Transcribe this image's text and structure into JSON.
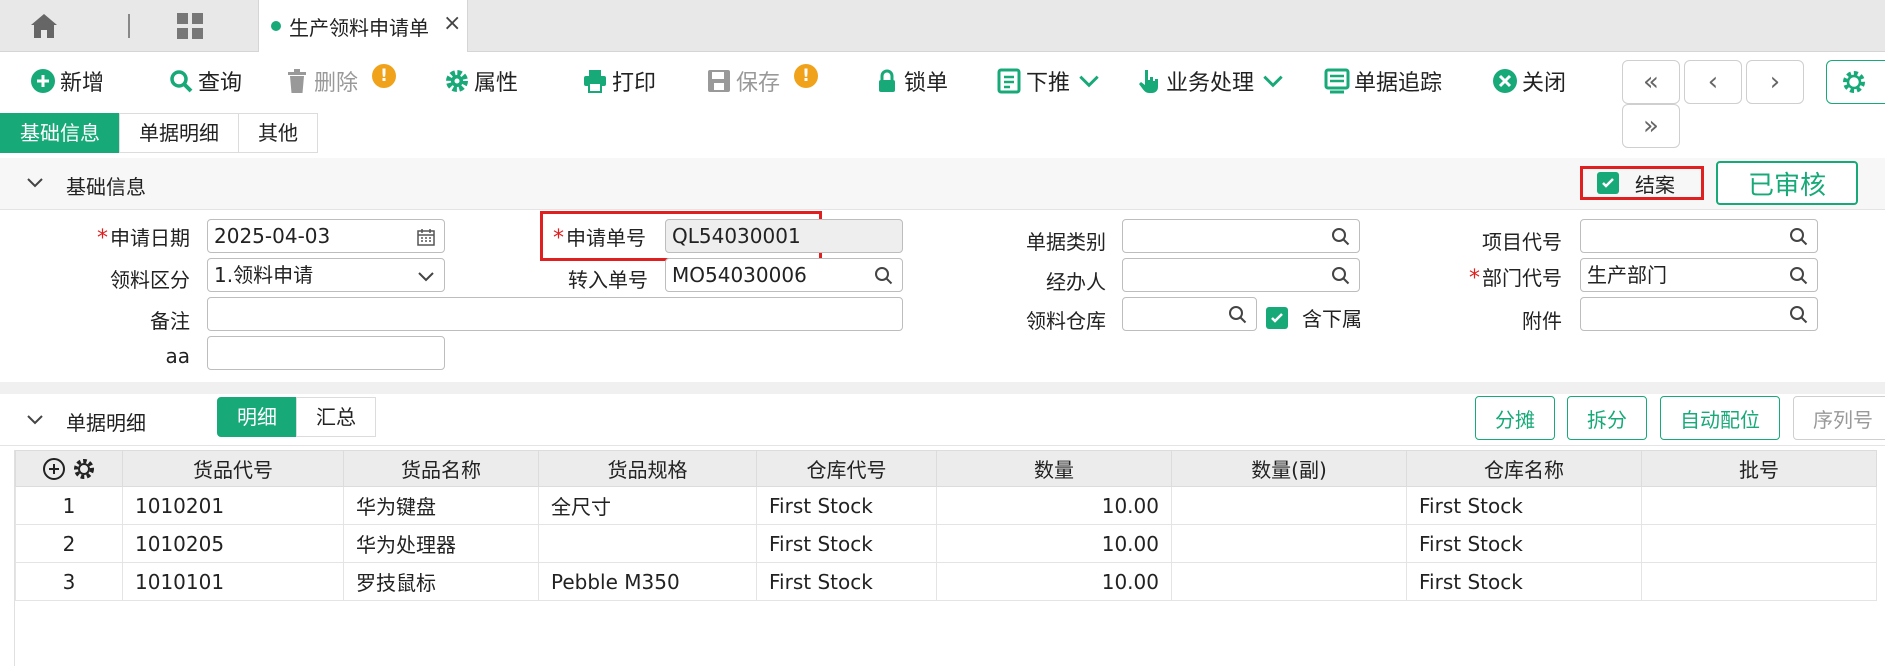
{
  "tab": {
    "title": "生产领料申请单"
  },
  "toolbar": {
    "add": "新增",
    "query": "查询",
    "delete": "删除",
    "properties": "属性",
    "print": "打印",
    "save": "保存",
    "lock": "锁单",
    "push_down": "下推",
    "business": "业务处理",
    "trace": "单据追踪",
    "close": "关闭"
  },
  "section_tabs": [
    "基础信息",
    "单据明细",
    "其他"
  ],
  "basic": {
    "title": "基础信息",
    "close_case_label": "结案",
    "status": "已审核",
    "fields": {
      "apply_date_label": "申请日期",
      "apply_date": "2025-04-03",
      "apply_no_label": "申请单号",
      "apply_no": "QL54030001",
      "doc_type_label": "单据类别",
      "doc_type": "",
      "project_label": "项目代号",
      "project": "",
      "category_label": "领料区分",
      "category": "1.领料申请",
      "transfer_label": "转入单号",
      "transfer": "MO54030006",
      "handler_label": "经办人",
      "handler": "",
      "dept_label": "部门代号",
      "dept": "生产部门",
      "remark_label": "备注",
      "remark": "",
      "warehouse_label": "领料仓库",
      "warehouse": "",
      "include_sub_label": "含下属",
      "attachment_label": "附件",
      "attachment": "",
      "aa_label": "aa",
      "aa": ""
    }
  },
  "detail": {
    "title": "单据明细",
    "views": [
      "明细",
      "汇总"
    ],
    "buttons": [
      "分摊",
      "拆分",
      "自动配位",
      "序列号"
    ],
    "columns": [
      "货品代号",
      "货品名称",
      "货品规格",
      "仓库代号",
      "数量",
      "数量(副)",
      "仓库名称",
      "批号"
    ],
    "rows": [
      [
        "1",
        "1010201",
        "华为键盘",
        "全尺寸",
        "First Stock",
        "10.00",
        "",
        "First Stock",
        ""
      ],
      [
        "2",
        "1010205",
        "华为处理器",
        "",
        "First Stock",
        "10.00",
        "",
        "First Stock",
        ""
      ],
      [
        "3",
        "1010101",
        "罗技鼠标",
        "Pebble M350",
        "First Stock",
        "10.00",
        "",
        "First Stock",
        ""
      ]
    ]
  },
  "colors": {
    "accent": "#18a979",
    "highlight": "#e02020",
    "warning": "#f0a21b"
  }
}
